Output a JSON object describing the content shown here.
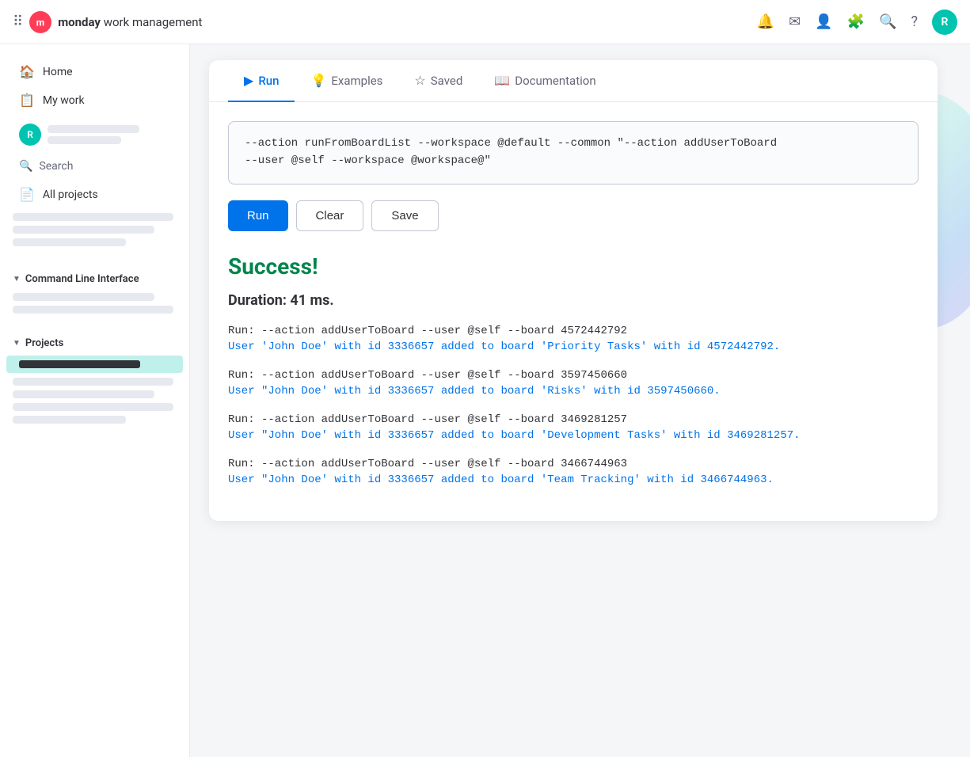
{
  "topbar": {
    "brand": "monday",
    "brand_suffix": "work management",
    "avatar_label": "R"
  },
  "sidebar": {
    "home_label": "Home",
    "mywork_label": "My work",
    "search_label": "Search",
    "allprojects_label": "All projects",
    "cli_section_label": "Command Line Interface",
    "projects_section_label": "Projects"
  },
  "tabs": [
    {
      "id": "run",
      "label": "Run",
      "icon": "▶"
    },
    {
      "id": "examples",
      "label": "Examples",
      "icon": "💡"
    },
    {
      "id": "saved",
      "label": "Saved",
      "icon": "☆"
    },
    {
      "id": "documentation",
      "label": "Documentation",
      "icon": "📖"
    }
  ],
  "command": {
    "text_line1": "--action runFromBoardList --workspace @default --common \"--action addUserToBoard",
    "text_line2": "--user @self --workspace @workspace@\""
  },
  "buttons": {
    "run": "Run",
    "clear": "Clear",
    "save": "Save"
  },
  "results": {
    "success_label": "Success!",
    "duration_label": "Duration: 41 ms.",
    "entries": [
      {
        "run": "Run: --action addUserToBoard --user @self --board 4572442792",
        "info": "User 'John Doe' with id 3336657 added to board 'Priority Tasks' with id 4572442792."
      },
      {
        "run": "Run: --action addUserToBoard --user @self --board 3597450660",
        "info": "User \"John Doe' with id 3336657 added to board 'Risks' with id 3597450660."
      },
      {
        "run": "Run: --action addUserToBoard --user @self --board 3469281257",
        "info": "User \"John Doe' with id 3336657 added to board 'Development Tasks' with id 3469281257."
      },
      {
        "run": "Run: --action addUserToBoard --user @self --board 3466744963",
        "info": "User \"John Doe' with id 3336657 added to board 'Team Tracking' with id 3466744963."
      }
    ]
  }
}
